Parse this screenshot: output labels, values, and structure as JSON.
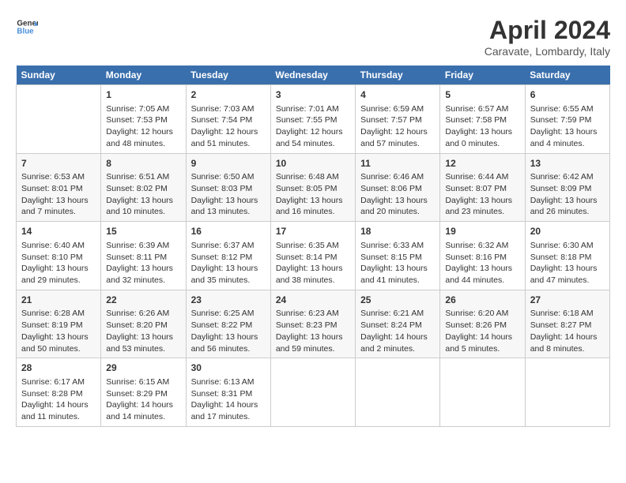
{
  "header": {
    "logo_line1": "General",
    "logo_line2": "Blue",
    "month_year": "April 2024",
    "location": "Caravate, Lombardy, Italy"
  },
  "calendar": {
    "days_of_week": [
      "Sunday",
      "Monday",
      "Tuesday",
      "Wednesday",
      "Thursday",
      "Friday",
      "Saturday"
    ],
    "weeks": [
      [
        {
          "day": "",
          "sunrise": "",
          "sunset": "",
          "daylight": "",
          "empty": true
        },
        {
          "day": "1",
          "sunrise": "Sunrise: 7:05 AM",
          "sunset": "Sunset: 7:53 PM",
          "daylight": "Daylight: 12 hours and 48 minutes."
        },
        {
          "day": "2",
          "sunrise": "Sunrise: 7:03 AM",
          "sunset": "Sunset: 7:54 PM",
          "daylight": "Daylight: 12 hours and 51 minutes."
        },
        {
          "day": "3",
          "sunrise": "Sunrise: 7:01 AM",
          "sunset": "Sunset: 7:55 PM",
          "daylight": "Daylight: 12 hours and 54 minutes."
        },
        {
          "day": "4",
          "sunrise": "Sunrise: 6:59 AM",
          "sunset": "Sunset: 7:57 PM",
          "daylight": "Daylight: 12 hours and 57 minutes."
        },
        {
          "day": "5",
          "sunrise": "Sunrise: 6:57 AM",
          "sunset": "Sunset: 7:58 PM",
          "daylight": "Daylight: 13 hours and 0 minutes."
        },
        {
          "day": "6",
          "sunrise": "Sunrise: 6:55 AM",
          "sunset": "Sunset: 7:59 PM",
          "daylight": "Daylight: 13 hours and 4 minutes."
        }
      ],
      [
        {
          "day": "7",
          "sunrise": "Sunrise: 6:53 AM",
          "sunset": "Sunset: 8:01 PM",
          "daylight": "Daylight: 13 hours and 7 minutes."
        },
        {
          "day": "8",
          "sunrise": "Sunrise: 6:51 AM",
          "sunset": "Sunset: 8:02 PM",
          "daylight": "Daylight: 13 hours and 10 minutes."
        },
        {
          "day": "9",
          "sunrise": "Sunrise: 6:50 AM",
          "sunset": "Sunset: 8:03 PM",
          "daylight": "Daylight: 13 hours and 13 minutes."
        },
        {
          "day": "10",
          "sunrise": "Sunrise: 6:48 AM",
          "sunset": "Sunset: 8:05 PM",
          "daylight": "Daylight: 13 hours and 16 minutes."
        },
        {
          "day": "11",
          "sunrise": "Sunrise: 6:46 AM",
          "sunset": "Sunset: 8:06 PM",
          "daylight": "Daylight: 13 hours and 20 minutes."
        },
        {
          "day": "12",
          "sunrise": "Sunrise: 6:44 AM",
          "sunset": "Sunset: 8:07 PM",
          "daylight": "Daylight: 13 hours and 23 minutes."
        },
        {
          "day": "13",
          "sunrise": "Sunrise: 6:42 AM",
          "sunset": "Sunset: 8:09 PM",
          "daylight": "Daylight: 13 hours and 26 minutes."
        }
      ],
      [
        {
          "day": "14",
          "sunrise": "Sunrise: 6:40 AM",
          "sunset": "Sunset: 8:10 PM",
          "daylight": "Daylight: 13 hours and 29 minutes."
        },
        {
          "day": "15",
          "sunrise": "Sunrise: 6:39 AM",
          "sunset": "Sunset: 8:11 PM",
          "daylight": "Daylight: 13 hours and 32 minutes."
        },
        {
          "day": "16",
          "sunrise": "Sunrise: 6:37 AM",
          "sunset": "Sunset: 8:12 PM",
          "daylight": "Daylight: 13 hours and 35 minutes."
        },
        {
          "day": "17",
          "sunrise": "Sunrise: 6:35 AM",
          "sunset": "Sunset: 8:14 PM",
          "daylight": "Daylight: 13 hours and 38 minutes."
        },
        {
          "day": "18",
          "sunrise": "Sunrise: 6:33 AM",
          "sunset": "Sunset: 8:15 PM",
          "daylight": "Daylight: 13 hours and 41 minutes."
        },
        {
          "day": "19",
          "sunrise": "Sunrise: 6:32 AM",
          "sunset": "Sunset: 8:16 PM",
          "daylight": "Daylight: 13 hours and 44 minutes."
        },
        {
          "day": "20",
          "sunrise": "Sunrise: 6:30 AM",
          "sunset": "Sunset: 8:18 PM",
          "daylight": "Daylight: 13 hours and 47 minutes."
        }
      ],
      [
        {
          "day": "21",
          "sunrise": "Sunrise: 6:28 AM",
          "sunset": "Sunset: 8:19 PM",
          "daylight": "Daylight: 13 hours and 50 minutes."
        },
        {
          "day": "22",
          "sunrise": "Sunrise: 6:26 AM",
          "sunset": "Sunset: 8:20 PM",
          "daylight": "Daylight: 13 hours and 53 minutes."
        },
        {
          "day": "23",
          "sunrise": "Sunrise: 6:25 AM",
          "sunset": "Sunset: 8:22 PM",
          "daylight": "Daylight: 13 hours and 56 minutes."
        },
        {
          "day": "24",
          "sunrise": "Sunrise: 6:23 AM",
          "sunset": "Sunset: 8:23 PM",
          "daylight": "Daylight: 13 hours and 59 minutes."
        },
        {
          "day": "25",
          "sunrise": "Sunrise: 6:21 AM",
          "sunset": "Sunset: 8:24 PM",
          "daylight": "Daylight: 14 hours and 2 minutes."
        },
        {
          "day": "26",
          "sunrise": "Sunrise: 6:20 AM",
          "sunset": "Sunset: 8:26 PM",
          "daylight": "Daylight: 14 hours and 5 minutes."
        },
        {
          "day": "27",
          "sunrise": "Sunrise: 6:18 AM",
          "sunset": "Sunset: 8:27 PM",
          "daylight": "Daylight: 14 hours and 8 minutes."
        }
      ],
      [
        {
          "day": "28",
          "sunrise": "Sunrise: 6:17 AM",
          "sunset": "Sunset: 8:28 PM",
          "daylight": "Daylight: 14 hours and 11 minutes."
        },
        {
          "day": "29",
          "sunrise": "Sunrise: 6:15 AM",
          "sunset": "Sunset: 8:29 PM",
          "daylight": "Daylight: 14 hours and 14 minutes."
        },
        {
          "day": "30",
          "sunrise": "Sunrise: 6:13 AM",
          "sunset": "Sunset: 8:31 PM",
          "daylight": "Daylight: 14 hours and 17 minutes."
        },
        {
          "day": "",
          "sunrise": "",
          "sunset": "",
          "daylight": "",
          "empty": true
        },
        {
          "day": "",
          "sunrise": "",
          "sunset": "",
          "daylight": "",
          "empty": true
        },
        {
          "day": "",
          "sunrise": "",
          "sunset": "",
          "daylight": "",
          "empty": true
        },
        {
          "day": "",
          "sunrise": "",
          "sunset": "",
          "daylight": "",
          "empty": true
        }
      ]
    ]
  }
}
